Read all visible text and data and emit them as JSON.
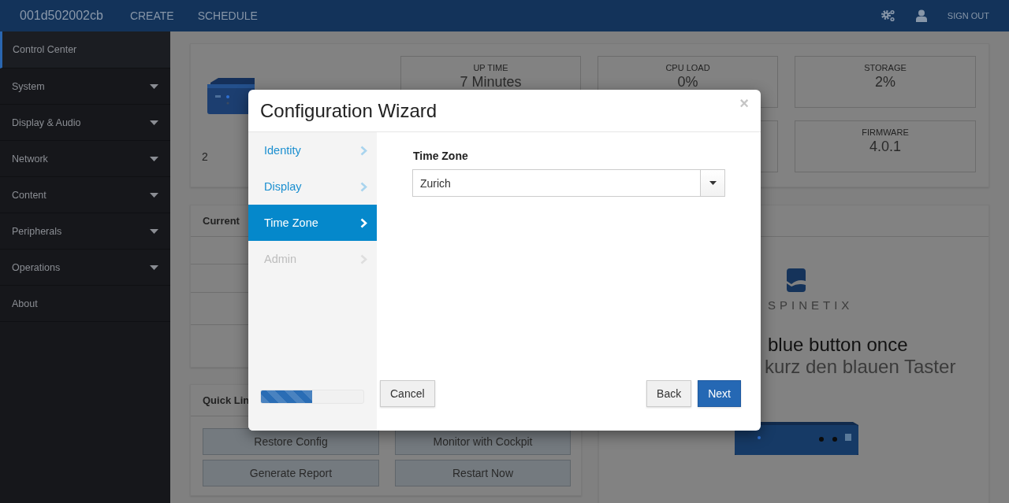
{
  "top_bar": {
    "device": "001d502002cb",
    "nav": [
      "CREATE",
      "SCHEDULE"
    ],
    "sign_out": "SIGN OUT"
  },
  "sidebar": {
    "items": [
      {
        "label": "Control Center",
        "selected": true,
        "kind": "link"
      },
      {
        "label": "System",
        "selected": false,
        "kind": "menu"
      },
      {
        "label": "Display & Audio",
        "selected": false,
        "kind": "menu"
      },
      {
        "label": "Network",
        "selected": false,
        "kind": "menu"
      },
      {
        "label": "Content",
        "selected": false,
        "kind": "menu"
      },
      {
        "label": "Peripherals",
        "selected": false,
        "kind": "menu"
      },
      {
        "label": "Operations",
        "selected": false,
        "kind": "menu"
      },
      {
        "label": "About",
        "selected": false,
        "kind": "link"
      }
    ]
  },
  "overview": {
    "device_caption": "2",
    "stats": [
      {
        "label": "UP TIME",
        "value": "7 Minutes"
      },
      {
        "label": "CPU LOAD",
        "value": "0%"
      },
      {
        "label": "STORAGE",
        "value": "2%"
      },
      {
        "label": "FIRMWARE",
        "value": "4.0.1"
      }
    ]
  },
  "status_card": {
    "title": "Current"
  },
  "quick_links": {
    "title": "Quick Lin",
    "buttons": [
      "Restore Config",
      "Monitor with Cockpit",
      "Generate Report",
      "Restart Now"
    ]
  },
  "instructions": {
    "logo_text": "SPINETIX",
    "line_1": "blue button once",
    "line_2": "kurz den blauen Taster"
  },
  "wizard": {
    "title": "Configuration Wizard",
    "close": "×",
    "steps": [
      {
        "label": "Identity",
        "selected": false,
        "disabled": false
      },
      {
        "label": "Display",
        "selected": false,
        "disabled": false
      },
      {
        "label": "Time Zone",
        "selected": true,
        "disabled": false
      },
      {
        "label": "Admin",
        "selected": false,
        "disabled": true
      }
    ],
    "progress": {
      "level": 0.5
    },
    "field": {
      "label": "Time Zone",
      "value": "Zurich"
    },
    "buttons": {
      "cancel": "Cancel",
      "back": "Back",
      "next": "Next"
    }
  }
}
